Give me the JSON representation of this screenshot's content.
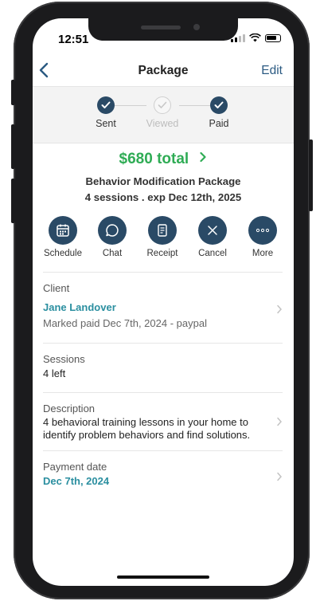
{
  "status_bar": {
    "time": "12:51"
  },
  "nav": {
    "title": "Package",
    "edit_label": "Edit"
  },
  "progress": {
    "steps": [
      {
        "label": "Sent",
        "state": "done"
      },
      {
        "label": "Viewed",
        "state": "inactive"
      },
      {
        "label": "Paid",
        "state": "done"
      }
    ]
  },
  "summary": {
    "total": "$680 total",
    "package_name": "Behavior Modification Package",
    "details": "4 sessions . exp Dec 12th, 2025"
  },
  "actions": [
    {
      "label": "Schedule",
      "icon": "calendar-icon"
    },
    {
      "label": "Chat",
      "icon": "chat-bubble-icon"
    },
    {
      "label": "Receipt",
      "icon": "receipt-icon"
    },
    {
      "label": "Cancel",
      "icon": "close-icon"
    },
    {
      "label": "More",
      "icon": "more-icon"
    }
  ],
  "client": {
    "title": "Client",
    "name": "Jane Landover",
    "note": "Marked paid Dec 7th, 2024 - paypal"
  },
  "sessions": {
    "title": "Sessions",
    "value": "4 left"
  },
  "description": {
    "title": "Description",
    "value_line1": "4 behavioral training lessons in your home to",
    "value_line2": "identify problem behaviors and find solutions."
  },
  "payment": {
    "title": "Payment date",
    "value": "Dec 7th, 2024"
  },
  "colors": {
    "accent_navy": "#2a4a66",
    "total_green": "#2fac55",
    "link_teal": "#2b8fa0"
  }
}
